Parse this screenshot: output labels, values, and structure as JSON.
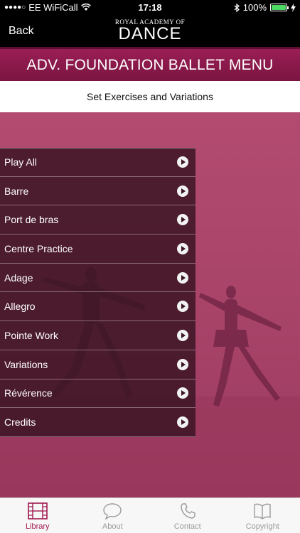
{
  "status": {
    "signal_dots": "●●●●○",
    "carrier": "EE WiFiCall",
    "time": "17:18",
    "battery": "100%"
  },
  "nav": {
    "back_label": "Back",
    "logo_small": "ROYAL ACADEMY OF",
    "logo_big": "DANCE"
  },
  "banner": {
    "title": "ADV. FOUNDATION BALLET MENU"
  },
  "subtitle": "Set Exercises and Variations",
  "menu": {
    "items": [
      {
        "label": "Play All"
      },
      {
        "label": "Barre"
      },
      {
        "label": "Port de bras"
      },
      {
        "label": "Centre Practice"
      },
      {
        "label": "Adage"
      },
      {
        "label": "Allegro"
      },
      {
        "label": "Pointe Work"
      },
      {
        "label": "Variations"
      },
      {
        "label": "Révérence"
      },
      {
        "label": "Credits"
      }
    ]
  },
  "tabs": [
    {
      "label": "Library",
      "icon": "film-icon",
      "active": true
    },
    {
      "label": "About",
      "icon": "speech-bubble-icon",
      "active": false
    },
    {
      "label": "Contact",
      "icon": "phone-icon",
      "active": false
    },
    {
      "label": "Copyright",
      "icon": "book-icon",
      "active": false
    }
  ],
  "colors": {
    "accent": "#a0174f",
    "banner": "#8a1a4b",
    "menu_bg": "#37141f"
  }
}
